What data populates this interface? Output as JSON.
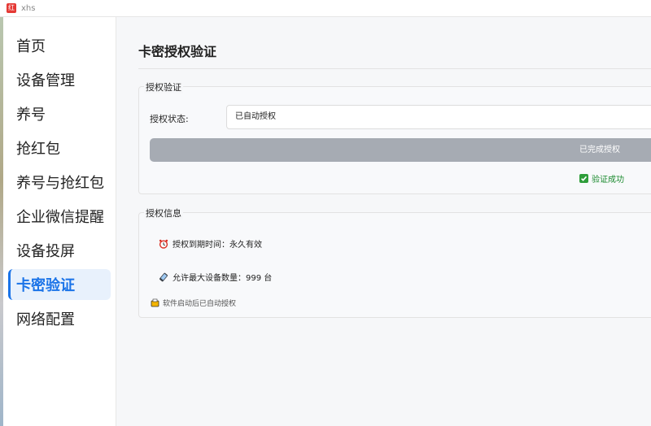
{
  "window": {
    "title": "xhs",
    "icon_text": "红"
  },
  "sidebar": {
    "items": [
      {
        "label": "首页"
      },
      {
        "label": "设备管理"
      },
      {
        "label": "养号"
      },
      {
        "label": "抢红包"
      },
      {
        "label": "养号与抢红包"
      },
      {
        "label": "企业微信提醒"
      },
      {
        "label": "设备投屏"
      },
      {
        "label": "卡密验证",
        "active": true
      },
      {
        "label": "网络配置"
      }
    ]
  },
  "main": {
    "page_title": "卡密授权验证",
    "auth_group": {
      "title": "授权验证",
      "status_label": "授权状态:",
      "status_value": "已自动授权",
      "button_label": "已完成授权",
      "verify_text": "验证成功"
    },
    "info_group": {
      "title": "授权信息",
      "expire_text": "授权到期时间：永久有效",
      "max_devices_text": "允许最大设备数量：999 台",
      "note_text": "软件启动后已自动授权"
    }
  },
  "colors": {
    "accent": "#1a73e8",
    "active_bg": "#e8f1fc",
    "button_disabled": "#a6abb3",
    "success": "#2e9d3a"
  }
}
